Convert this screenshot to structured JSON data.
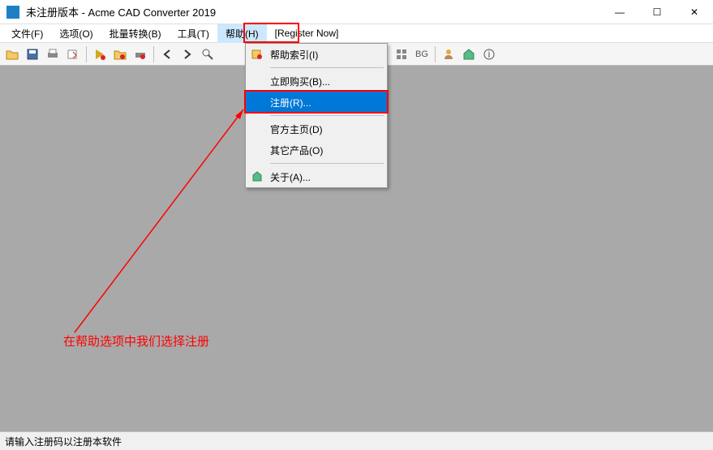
{
  "title": "未注册版本 - Acme CAD Converter 2019",
  "window_controls": {
    "min": "—",
    "max": "☐",
    "close": "✕"
  },
  "menubar": {
    "items": [
      {
        "label": "文件(F)"
      },
      {
        "label": "选项(O)"
      },
      {
        "label": "批量转换(B)"
      },
      {
        "label": "工具(T)"
      },
      {
        "label": "帮助(H)"
      },
      {
        "label": "[Register Now]"
      }
    ]
  },
  "toolbar": {
    "bg_label": "BG"
  },
  "dropdown": {
    "items": [
      {
        "label": "帮助索引(I)",
        "icon": "help-book"
      },
      {
        "label": "立即购买(B)..."
      },
      {
        "label": "注册(R)..."
      },
      {
        "label": "官方主页(D)"
      },
      {
        "label": "其它产品(O)"
      },
      {
        "label": "关于(A)...",
        "icon": "home"
      }
    ]
  },
  "annotation_text": "在帮助选项中我们选择注册",
  "statusbar_text": "请输入注册码以注册本软件"
}
